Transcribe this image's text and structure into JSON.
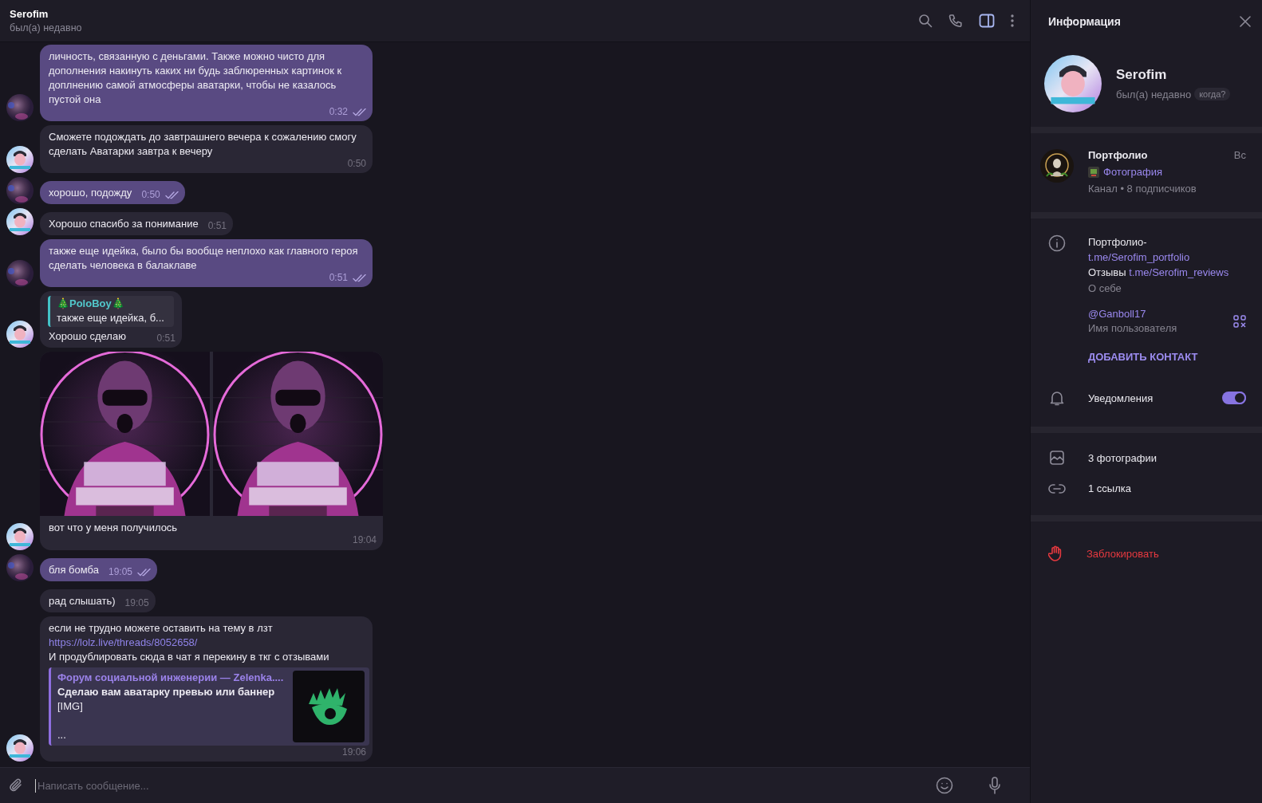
{
  "header": {
    "name": "Serofim",
    "status": "был(а) недавно"
  },
  "messages": [
    {
      "kind": "text",
      "outgoing": true,
      "show_avatar": true,
      "text": "личность, связанную с деньгами. Также можно чисто для дополнения накинуть каких ни будь заблюренных картинок к доплнению самой атмосферы аватарки, чтобы не казалось пустой она",
      "time": "0:32",
      "read": true
    },
    {
      "kind": "text",
      "outgoing": false,
      "show_avatar": true,
      "text": "Сможете подождать до завтрашнего вечера к сожалению смогу сделать Аватарки завтра к вечеру",
      "time": "0:50"
    },
    {
      "kind": "text",
      "outgoing": true,
      "show_avatar": true,
      "text": "хорошо, подожду",
      "time": "0:50",
      "read": true
    },
    {
      "kind": "text",
      "outgoing": false,
      "show_avatar": true,
      "text": "Хорошо спасибо за понимание",
      "time": "0:51"
    },
    {
      "kind": "text",
      "outgoing": true,
      "show_avatar": true,
      "text": "также еще идейка, было бы вообще неплохо как главного героя сделать человека в балаклаве",
      "time": "0:51",
      "read": true
    },
    {
      "kind": "reply",
      "outgoing": false,
      "show_avatar": true,
      "reply_author": "🎄PoloBoy🎄",
      "reply_text": "также еще идейка, б...",
      "text": "Хорошо сделаю",
      "time": "0:51"
    },
    {
      "kind": "photos",
      "outgoing": false,
      "show_avatar": true,
      "text": "вот что у меня получилось",
      "time": "19:04"
    },
    {
      "kind": "text",
      "outgoing": true,
      "show_avatar": true,
      "text": "бля бомба",
      "time": "19:05",
      "read": true
    },
    {
      "kind": "text",
      "outgoing": false,
      "show_avatar": false,
      "text": "рад слышать)",
      "time": "19:05"
    },
    {
      "kind": "link",
      "outgoing": false,
      "show_avatar": true,
      "text": "если не трудно можете оставить на тему в лзт",
      "link": "https://lolz.live/threads/8052658/",
      "text_after": "И продублировать сюда в чат я перекину в ткг с отзывами",
      "preview": {
        "site": "Форум социальной инженерии —  Zelenka....",
        "title": "Сделаю  вам аватарку превью или баннер",
        "description": "[IMG]",
        "more": "..."
      },
      "time": "19:06"
    }
  ],
  "composer": {
    "placeholder": "Написать сообщение..."
  },
  "info": {
    "title": "Информация",
    "name": "Serofim",
    "status": "был(а) недавно",
    "when_badge": "когда?",
    "channel": {
      "name": "Портфолио",
      "day": "Вс",
      "post": "Фотография",
      "meta": "Канал • 8 подписчиков"
    },
    "bio": [
      {
        "text": "Портфолио-"
      },
      {
        "link": "t.me/Serofim_portfolio"
      },
      {
        "text": "Отзывы",
        "link": "t.me/Serofim_reviews"
      }
    ],
    "bio_label": "О себе",
    "username": "@Ganboll17",
    "username_label": "Имя пользователя",
    "add_contact": "ДОБАВИТЬ КОНТАКТ",
    "notifications": {
      "label": "Уведомления",
      "on": true
    },
    "media": [
      {
        "kind": "photos",
        "label": "3 фотографии"
      },
      {
        "kind": "links",
        "label": "1 ссылка"
      }
    ],
    "block": "Заблокировать"
  }
}
